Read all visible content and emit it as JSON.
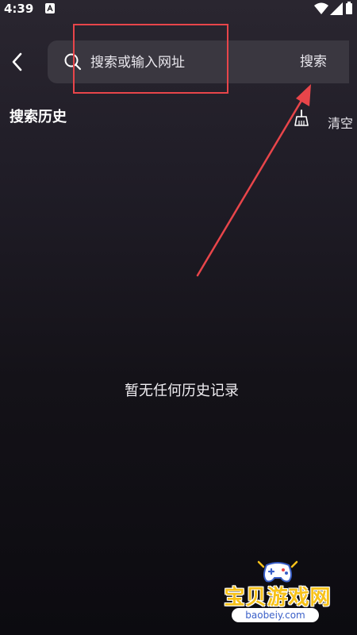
{
  "status_bar": {
    "time": "4:39",
    "icons": [
      "notification-a-icon",
      "wifi-icon",
      "signal-icon",
      "battery-icon"
    ]
  },
  "header": {
    "back_icon": "chevron-left-icon",
    "search": {
      "icon": "search-icon",
      "placeholder": "搜索或输入网址",
      "value": "",
      "submit_label": "搜索"
    }
  },
  "history": {
    "title": "搜索历史",
    "clear_icon": "broom-icon",
    "clear_label": "清空",
    "empty_message": "暂无任何历史记录"
  },
  "watermark": {
    "brand": "宝贝游戏网",
    "url": "baobeiy.com"
  },
  "colors": {
    "annotation": "#e8454a",
    "background_top": "#2a2630",
    "background_bottom": "#0c0b10",
    "search_bar": "#3a3740",
    "watermark_gold": "#f7c21a"
  }
}
